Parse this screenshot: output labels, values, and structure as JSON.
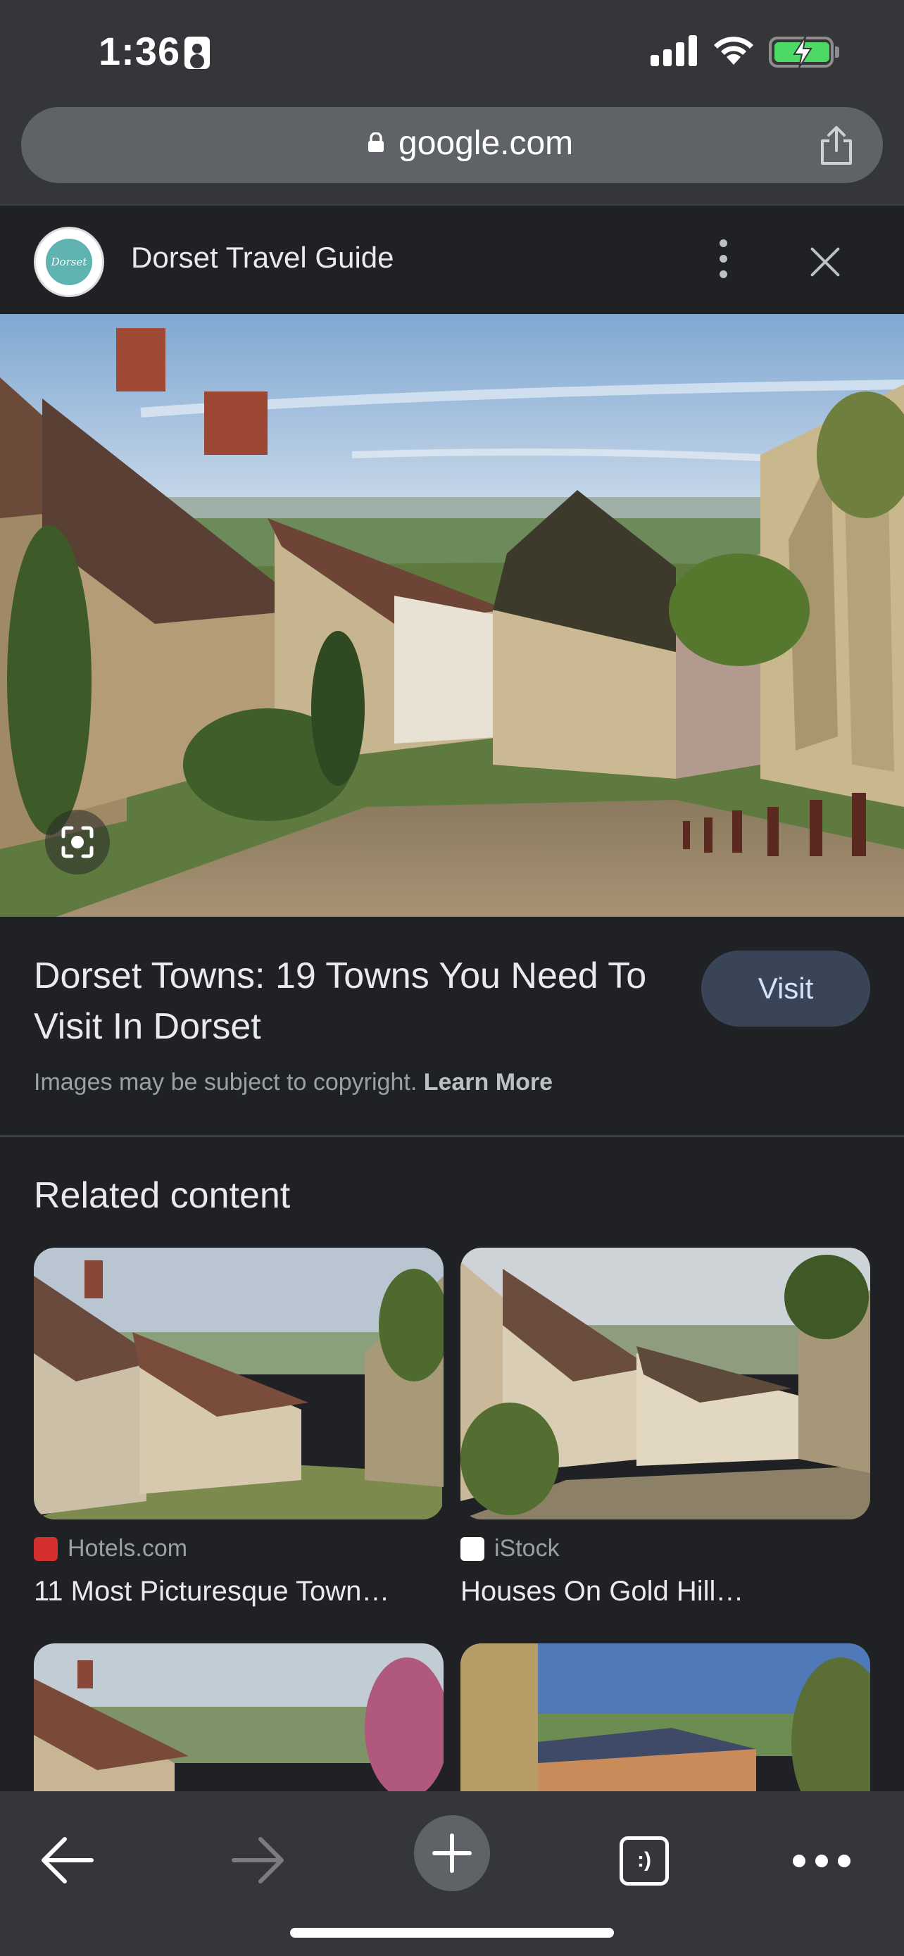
{
  "status_bar": {
    "time": "1:36"
  },
  "address_bar": {
    "url": "google.com"
  },
  "panel": {
    "site_name": "Dorset Travel Guide",
    "logo_text": "Dorset"
  },
  "result": {
    "title": "Dorset Towns: 19 Towns You Need To Visit In Dorset",
    "visit_label": "Visit",
    "copyright_text": "Images may be subject to copyright.",
    "learn_more_label": "Learn More"
  },
  "related": {
    "heading": "Related content",
    "items": [
      {
        "source": "Hotels.com",
        "caption": "11 Most Picturesque Town…"
      },
      {
        "source": "iStock",
        "caption": "Houses On Gold Hill…"
      }
    ]
  },
  "toolbar": {
    "tabs_label": ":)"
  },
  "icons": {
    "back": "back-arrow-icon",
    "forward": "forward-arrow-icon",
    "new_tab": "plus-icon",
    "tabs": "tab-switcher-icon",
    "more": "more-horiz-icon",
    "share": "share-icon",
    "lock": "lock-icon",
    "lens": "lens-icon"
  },
  "colors": {
    "background": "#202124",
    "toolbar": "#35363a",
    "visit_button": "#394457"
  }
}
